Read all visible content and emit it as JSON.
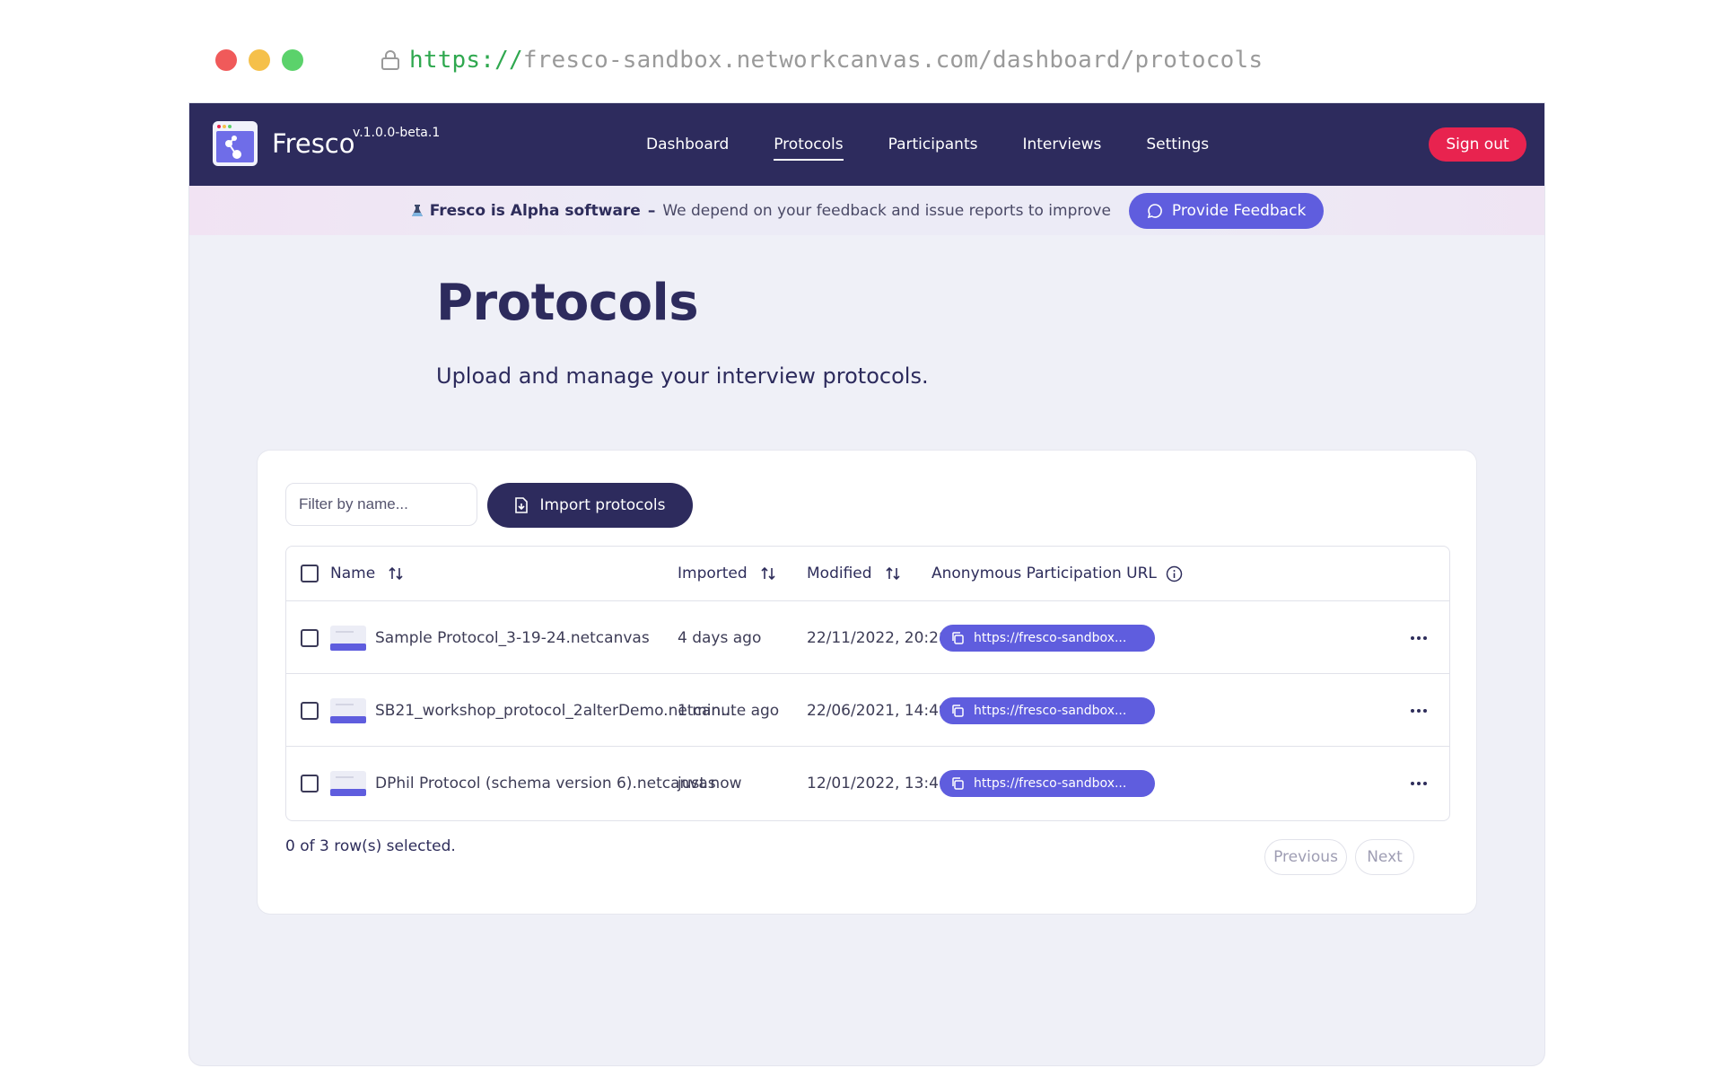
{
  "browser": {
    "url_scheme": "https://",
    "url_rest": "fresco-sandbox.networkcanvas.com/dashboard/protocols",
    "dot_colors": [
      "#f05a5a",
      "#f5c04a",
      "#5bd26b"
    ]
  },
  "nav": {
    "brand": "Fresco",
    "version": "v.1.0.0-beta.1",
    "links": [
      "Dashboard",
      "Protocols",
      "Participants",
      "Interviews",
      "Settings"
    ],
    "active_link": "Protocols",
    "sign_out": "Sign out"
  },
  "banner": {
    "title": "Fresco is Alpha software",
    "separator": "–",
    "message": "We depend on your feedback and issue reports to improve",
    "button": "Provide Feedback"
  },
  "page": {
    "title": "Protocols",
    "subtitle": "Upload and manage your interview protocols."
  },
  "toolbar": {
    "filter_placeholder": "Filter by name...",
    "import_button": "Import protocols"
  },
  "table": {
    "headers": {
      "name": "Name",
      "imported": "Imported",
      "modified": "Modified",
      "url": "Anonymous Participation URL"
    },
    "rows": [
      {
        "name": "Sample Protocol_3-19-24.netcanvas",
        "imported": "4 days ago",
        "modified": "22/11/2022, 20:28",
        "url": "https://fresco-sandbox..."
      },
      {
        "name": "SB21_workshop_protocol_2alterDemo.netcan...",
        "imported": "1 minute ago",
        "modified": "22/06/2021, 14:49",
        "url": "https://fresco-sandbox..."
      },
      {
        "name": "DPhil Protocol (schema version 6).netcanvas",
        "imported": "just now",
        "modified": "12/01/2022, 13:46",
        "url": "https://fresco-sandbox..."
      }
    ]
  },
  "footer": {
    "selection": "0 of 3 row(s) selected.",
    "previous": "Previous",
    "next": "Next"
  },
  "colors": {
    "navbar": "#2d2b5d",
    "accent": "#5f5dde",
    "sign_out": "#e8234f",
    "page_bg": "#eff0f7"
  }
}
